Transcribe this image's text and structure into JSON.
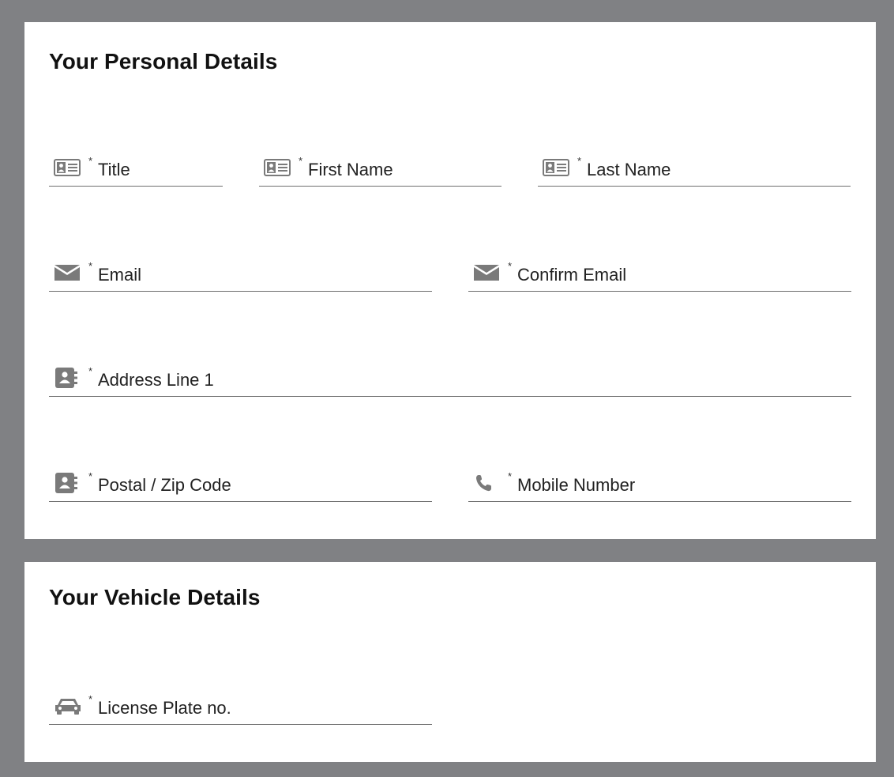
{
  "personal": {
    "title": "Your Personal Details",
    "fields": {
      "title": {
        "label": "Title",
        "required": "*",
        "icon": "id-card-icon"
      },
      "first_name": {
        "label": "First Name",
        "required": "*",
        "icon": "id-card-icon"
      },
      "last_name": {
        "label": "Last Name",
        "required": "*",
        "icon": "id-card-icon"
      },
      "email": {
        "label": "Email",
        "required": "*",
        "icon": "envelope-icon"
      },
      "confirm_email": {
        "label": "Confirm Email",
        "required": "*",
        "icon": "envelope-icon"
      },
      "address_line_1": {
        "label": "Address Line 1",
        "required": "*",
        "icon": "address-book-icon"
      },
      "postal_code": {
        "label": "Postal / Zip Code",
        "required": "*",
        "icon": "address-book-icon"
      },
      "mobile_number": {
        "label": "Mobile Number",
        "required": "*",
        "icon": "phone-icon"
      }
    }
  },
  "vehicle": {
    "title": "Your Vehicle Details",
    "fields": {
      "license_plate": {
        "label": "License Plate no.",
        "required": "*",
        "icon": "car-icon"
      }
    }
  },
  "colors": {
    "page_background": "#808184",
    "card_background": "#ffffff",
    "icon_gray": "#7a7a7a",
    "underline": "#6e6e6e"
  }
}
